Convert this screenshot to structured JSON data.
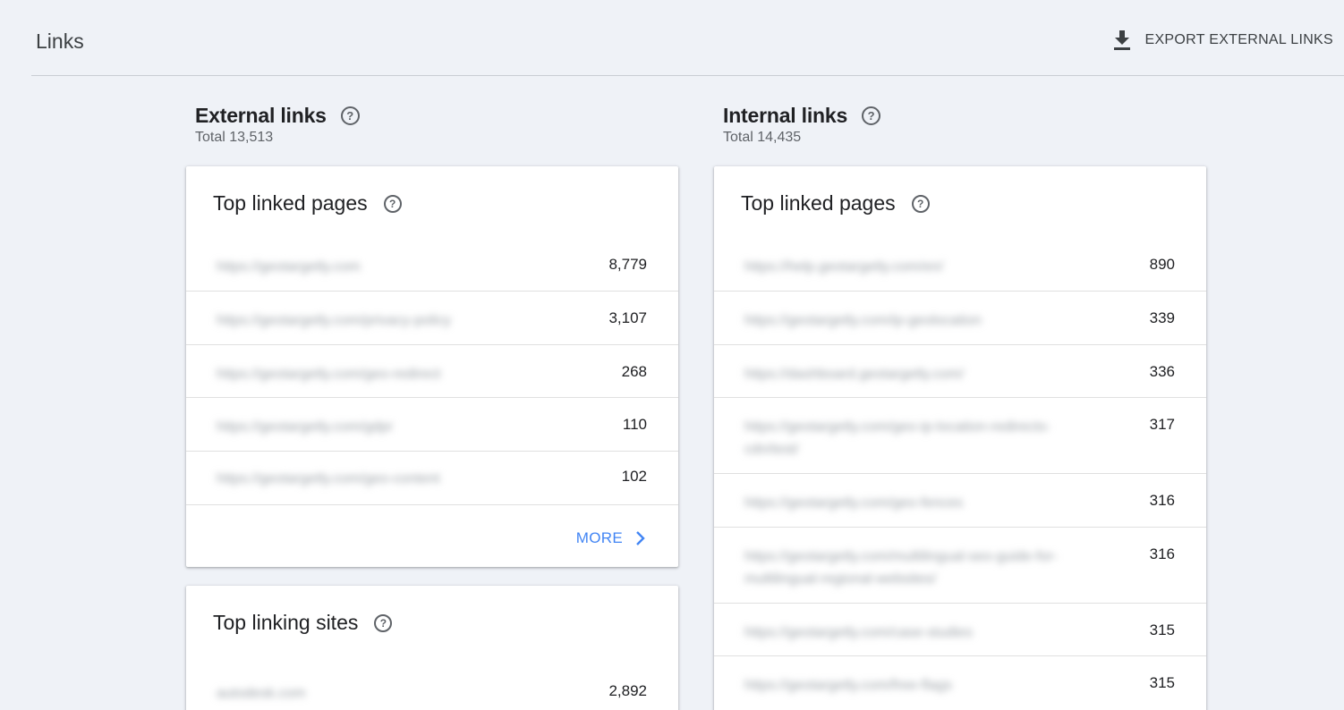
{
  "header": {
    "title": "Links",
    "export_label": "EXPORT EXTERNAL LINKS"
  },
  "external": {
    "title": "External links",
    "total": "Total 13,513",
    "top_linked_pages": {
      "title": "Top linked pages",
      "rows": [
        {
          "url": "https://geotargetly.com",
          "count": "8,779"
        },
        {
          "url": "https://geotargetly.com/privacy-policy",
          "count": "3,107"
        },
        {
          "url": "https://geotargetly.com/geo-redirect",
          "count": "268"
        },
        {
          "url": "https://geotargetly.com/gdpr",
          "count": "110"
        },
        {
          "url": "https://geotargetly.com/geo-content",
          "count": "102"
        }
      ],
      "more_label": "MORE"
    },
    "top_linking_sites": {
      "title": "Top linking sites",
      "rows": [
        {
          "url": "autodesk.com",
          "count": "2,892"
        }
      ]
    }
  },
  "internal": {
    "title": "Internal links",
    "total": "Total 14,435",
    "top_linked_pages": {
      "title": "Top linked pages",
      "rows": [
        {
          "url": "https://help.geotargetly.com/en/",
          "count": "890"
        },
        {
          "url": "https://geotargetly.com/ip-geolocation",
          "count": "339"
        },
        {
          "url": "https://dashboard.geotargetly.com/",
          "count": "336"
        },
        {
          "url": "https://geotargetly.com/geo-ip-location-redirects-cdn/test/",
          "count": "317"
        },
        {
          "url": "https://geotargetly.com/geo-fences",
          "count": "316"
        },
        {
          "url": "https://geotargetly.com/multilingual-seo-guide-for-multilingual-regional-websites/",
          "count": "316"
        },
        {
          "url": "https://geotargetly.com/case-studies",
          "count": "315"
        },
        {
          "url": "https://geotargetly.com/free-flags",
          "count": "315"
        }
      ]
    }
  }
}
